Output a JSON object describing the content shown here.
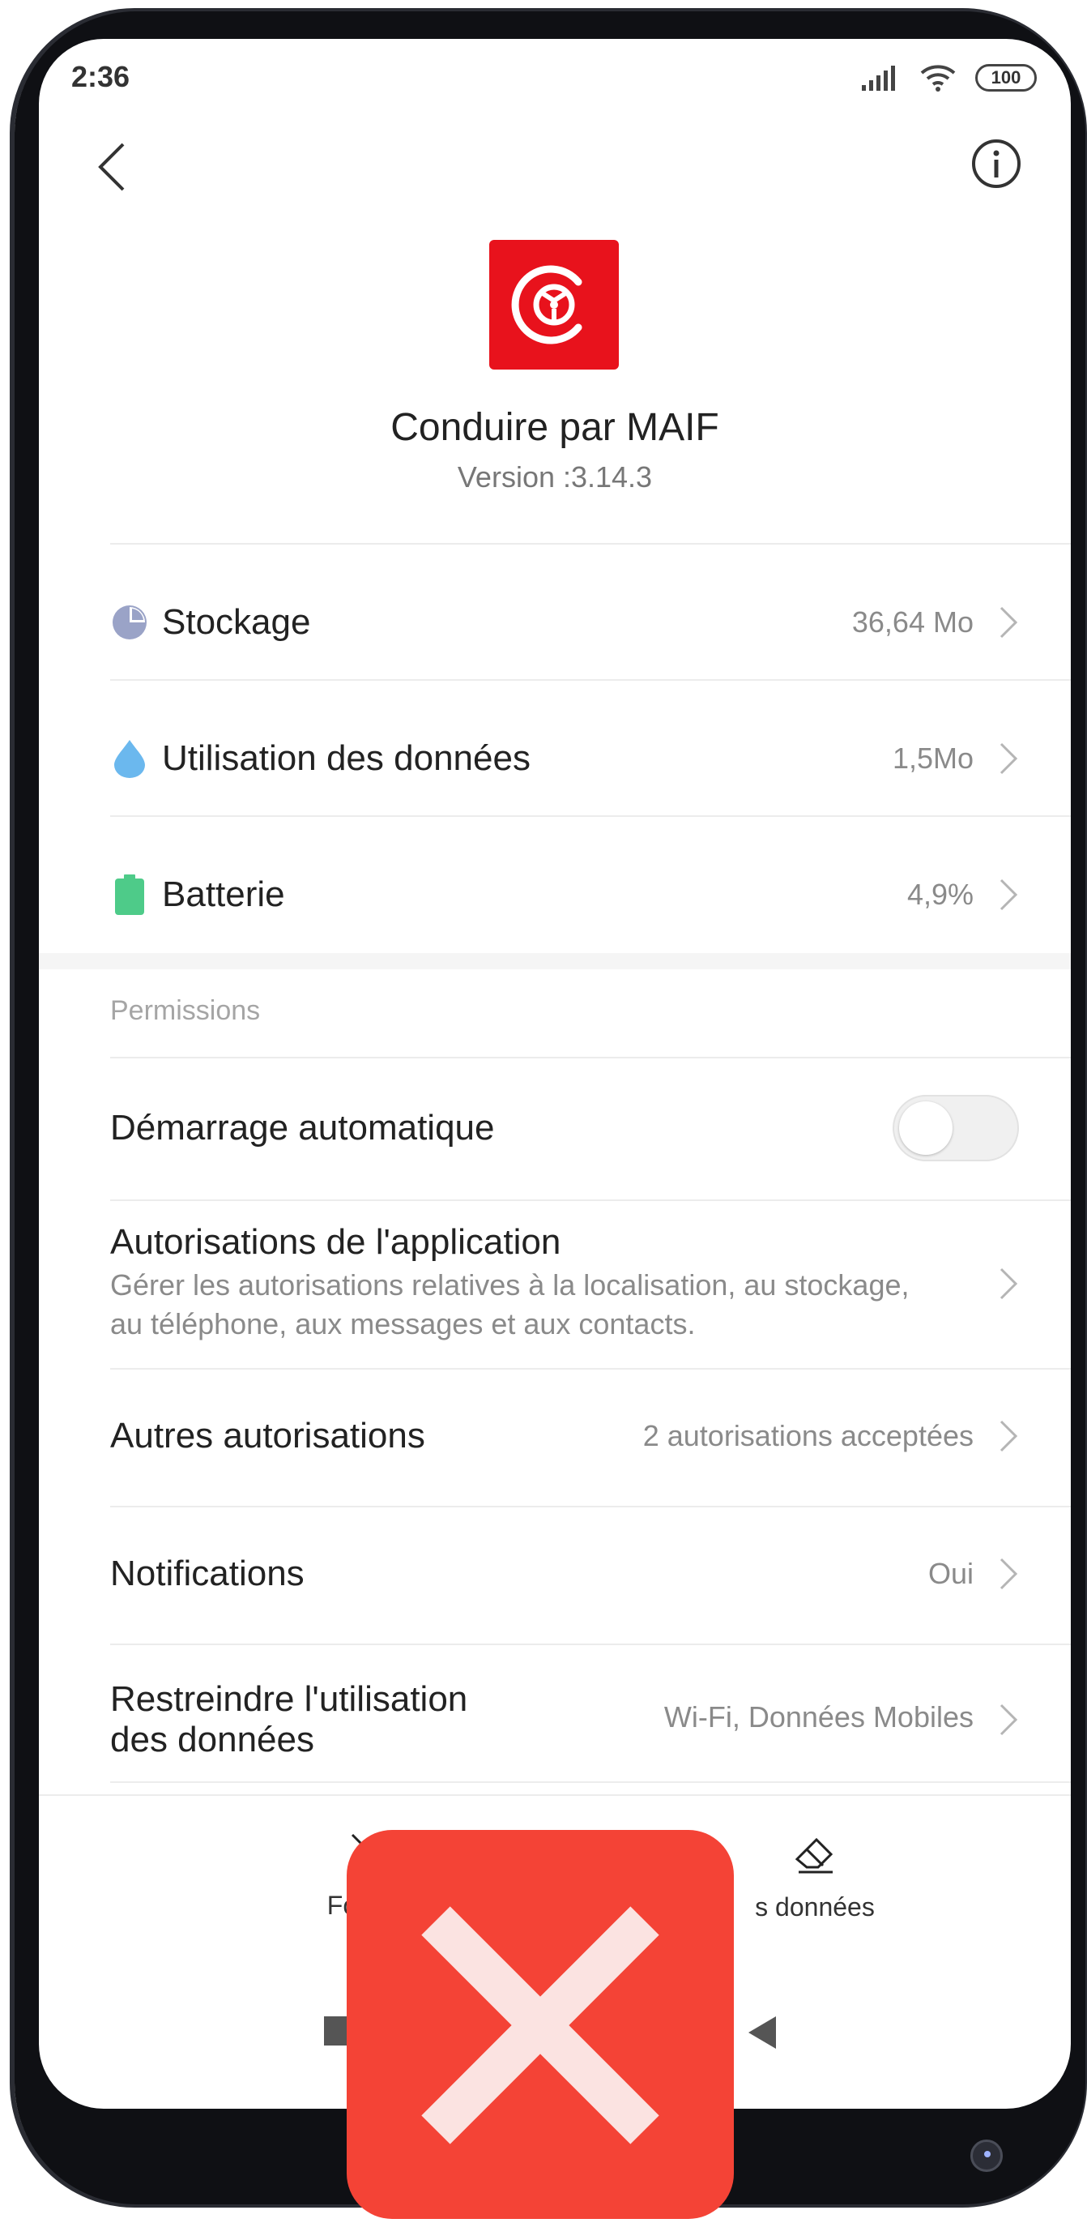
{
  "status_bar": {
    "time": "2:36",
    "battery": "100"
  },
  "header": {
    "app_name": "Conduire par MAIF",
    "version": "Version :3.14.3",
    "colors": {
      "app_icon_bg": "#e8121c"
    }
  },
  "rows": {
    "storage": {
      "label": "Stockage",
      "value": "36,64 Mo",
      "icon": "pie-chart-icon",
      "color": "#9aa3c7"
    },
    "data": {
      "label": "Utilisation des données",
      "value": "1,5Mo",
      "icon": "water-drop-icon",
      "color": "#6bb8ee"
    },
    "battery": {
      "label": "Batterie",
      "value": "4,9%",
      "icon": "battery-icon",
      "color": "#4ecb89"
    }
  },
  "permissions": {
    "section_title": "Permissions",
    "autostart": {
      "label": "Démarrage automatique",
      "enabled": false
    },
    "app_permissions": {
      "label": "Autorisations de l'application",
      "desc_line1": "Gérer les autorisations relatives à la localisation, au stockage,",
      "desc_line2": "au téléphone, aux messages et aux contacts."
    },
    "other_permissions": {
      "label": "Autres autorisations",
      "value": "2 autorisations acceptées"
    },
    "notifications": {
      "label": "Notifications",
      "value": "Oui"
    },
    "restrict_data": {
      "label_line1": "Restreindre l'utilisation",
      "label_line2": "des données",
      "value": "Wi-Fi, Données Mobiles"
    }
  },
  "bottom_actions": {
    "force_stop": "Forcer l",
    "clear_data": "s données"
  },
  "overlay": {
    "icon": "close-x-icon",
    "color": "#f44336"
  }
}
